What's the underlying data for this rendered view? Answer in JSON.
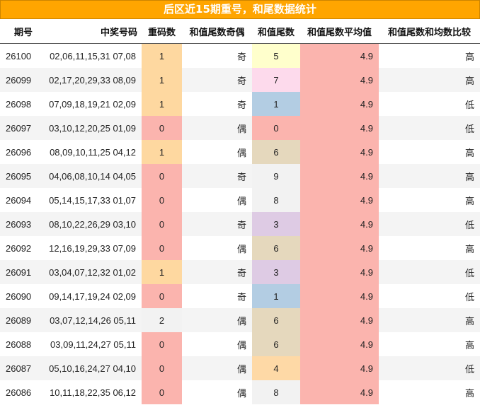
{
  "title": "后区近15期重号，和尾数据统计",
  "headers": {
    "period": "期号",
    "numbers": "中奖号码",
    "repeat": "重码数",
    "parity": "和值尾数奇偶",
    "tail": "和值尾数",
    "avg": "和值尾数平均值",
    "compare": "和值尾数和均数比较"
  },
  "colors": {
    "title_bg": "#ffa500",
    "repeat_1": "#fed8a0",
    "repeat_0": "#fbb4ae",
    "repeat_2": "#f2f2f2",
    "tail_0": "#fbb4ae",
    "tail_1": "#b3cde3",
    "tail_3": "#decbe4",
    "tail_4": "#fed9a6",
    "tail_5": "#ffffcc",
    "tail_6": "#e5d8bd",
    "tail_7": "#fddaec",
    "tail_8": "#f2f2f2",
    "tail_9": "#f2f2f2",
    "avg": "#fbb4ae"
  },
  "rows": [
    {
      "period": "26100",
      "numbers": "02,06,11,15,31 07,08",
      "repeat": "1",
      "parity": "奇",
      "tail": "5",
      "avg": "4.9",
      "compare": "高"
    },
    {
      "period": "26099",
      "numbers": "02,17,20,29,33 08,09",
      "repeat": "1",
      "parity": "奇",
      "tail": "7",
      "avg": "4.9",
      "compare": "高"
    },
    {
      "period": "26098",
      "numbers": "07,09,18,19,21 02,09",
      "repeat": "1",
      "parity": "奇",
      "tail": "1",
      "avg": "4.9",
      "compare": "低"
    },
    {
      "period": "26097",
      "numbers": "03,10,12,20,25 01,09",
      "repeat": "0",
      "parity": "偶",
      "tail": "0",
      "avg": "4.9",
      "compare": "低"
    },
    {
      "period": "26096",
      "numbers": "08,09,10,11,25 04,12",
      "repeat": "1",
      "parity": "偶",
      "tail": "6",
      "avg": "4.9",
      "compare": "高"
    },
    {
      "period": "26095",
      "numbers": "04,06,08,10,14 04,05",
      "repeat": "0",
      "parity": "奇",
      "tail": "9",
      "avg": "4.9",
      "compare": "高"
    },
    {
      "period": "26094",
      "numbers": "05,14,15,17,33 01,07",
      "repeat": "0",
      "parity": "偶",
      "tail": "8",
      "avg": "4.9",
      "compare": "高"
    },
    {
      "period": "26093",
      "numbers": "08,10,22,26,29 03,10",
      "repeat": "0",
      "parity": "奇",
      "tail": "3",
      "avg": "4.9",
      "compare": "低"
    },
    {
      "period": "26092",
      "numbers": "12,16,19,29,33 07,09",
      "repeat": "0",
      "parity": "偶",
      "tail": "6",
      "avg": "4.9",
      "compare": "高"
    },
    {
      "period": "26091",
      "numbers": "03,04,07,12,32 01,02",
      "repeat": "1",
      "parity": "奇",
      "tail": "3",
      "avg": "4.9",
      "compare": "低"
    },
    {
      "period": "26090",
      "numbers": "09,14,17,19,24 02,09",
      "repeat": "0",
      "parity": "奇",
      "tail": "1",
      "avg": "4.9",
      "compare": "低"
    },
    {
      "period": "26089",
      "numbers": "03,07,12,14,26 05,11",
      "repeat": "2",
      "parity": "偶",
      "tail": "6",
      "avg": "4.9",
      "compare": "高"
    },
    {
      "period": "26088",
      "numbers": "03,09,11,24,27 05,11",
      "repeat": "0",
      "parity": "偶",
      "tail": "6",
      "avg": "4.9",
      "compare": "高"
    },
    {
      "period": "26087",
      "numbers": "05,10,16,24,27 04,10",
      "repeat": "0",
      "parity": "偶",
      "tail": "4",
      "avg": "4.9",
      "compare": "低"
    },
    {
      "period": "26086",
      "numbers": "10,11,18,22,35 06,12",
      "repeat": "0",
      "parity": "偶",
      "tail": "8",
      "avg": "4.9",
      "compare": "高"
    }
  ]
}
